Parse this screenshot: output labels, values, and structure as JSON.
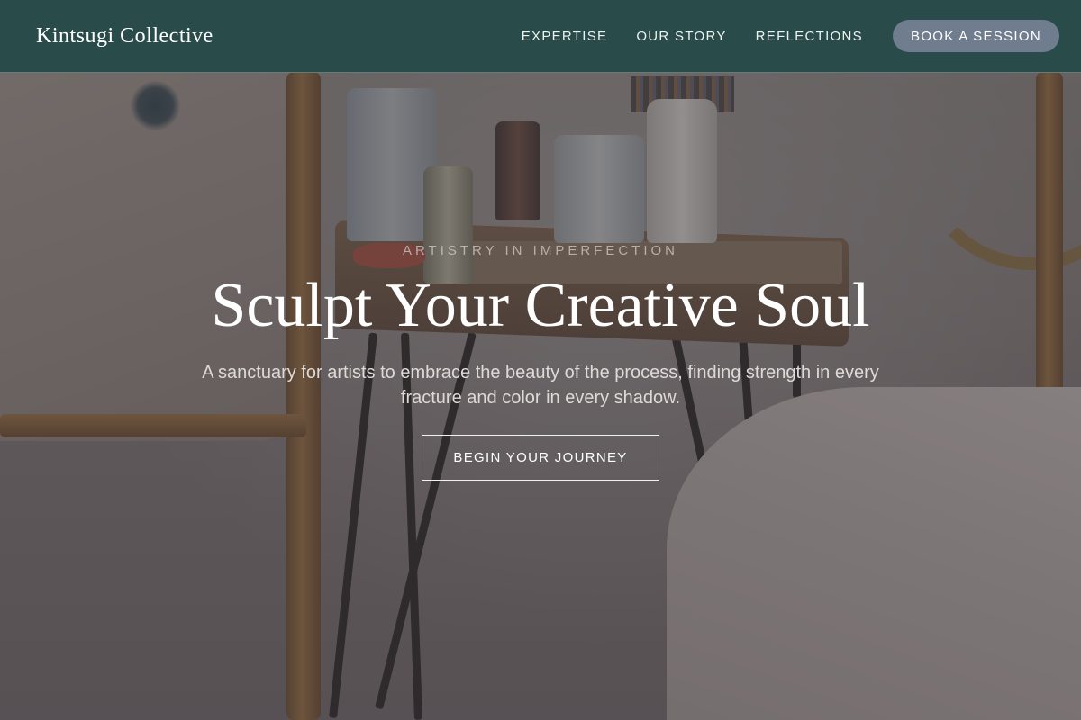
{
  "header": {
    "brand": "Kintsugi Collective",
    "nav": [
      "EXPERTISE",
      "OUR STORY",
      "REFLECTIONS"
    ],
    "cta_label": "BOOK A SESSION"
  },
  "hero": {
    "eyebrow": "ARTISTRY IN IMPERFECTION",
    "title": "Sculpt Your Creative Soul",
    "subtitle": "A sanctuary for artists to embrace the beauty of the process, finding strength in every fracture and color in every shadow.",
    "cta_label": "BEGIN YOUR JOURNEY"
  },
  "colors": {
    "header_bg": "#244a48",
    "book_button_bg": "#6f7d8f",
    "text_primary": "#ffffff"
  }
}
